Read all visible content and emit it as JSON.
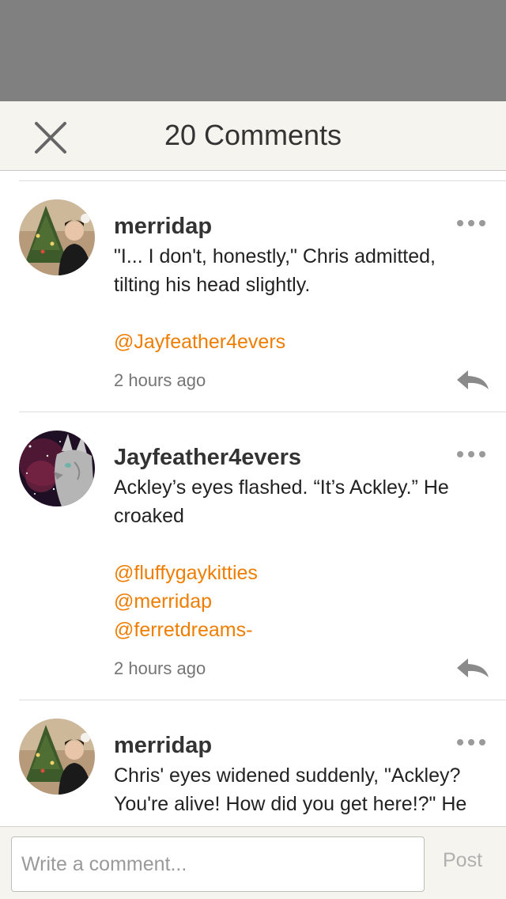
{
  "header": {
    "title": "20 Comments"
  },
  "comments": [
    {
      "username": "merridap",
      "text": "\"I... I don't, honestly,\" Chris admitted, tilting his head slightly.",
      "mentions": [
        "@Jayfeather4evers"
      ],
      "time": "2 hours ago"
    },
    {
      "username": "Jayfeather4evers",
      "text": "Ackley’s eyes flashed. “It’s Ackley.” He croaked",
      "mentions": [
        "@fluffygaykitties",
        "@merridap",
        "@ferretdreams-"
      ],
      "time": "2 hours ago"
    },
    {
      "username": "merridap",
      "text": "Chris' eyes widened suddenly, \"Ackley? You're alive! How did you get here!?\" He",
      "mentions": [],
      "time": ""
    }
  ],
  "composer": {
    "placeholder": "Write a comment...",
    "post_label": "Post"
  },
  "colors": {
    "accent": "#ee7d00",
    "overlay": "#808080",
    "header_bg": "#f5f4ee"
  }
}
